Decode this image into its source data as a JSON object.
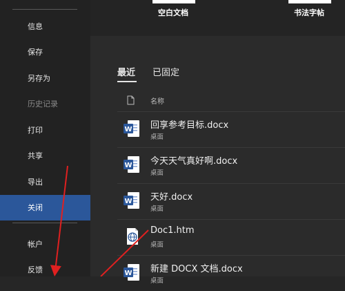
{
  "sidebar": {
    "items": [
      {
        "label": "信息"
      },
      {
        "label": "保存"
      },
      {
        "label": "另存为"
      },
      {
        "label": "历史记录"
      },
      {
        "label": "打印"
      },
      {
        "label": "共享"
      },
      {
        "label": "导出"
      },
      {
        "label": "关闭"
      },
      {
        "label": "帐户"
      },
      {
        "label": "反馈"
      }
    ],
    "active_index": 7,
    "disabled_index": 3
  },
  "templates": [
    {
      "label": "空白文档"
    },
    {
      "label": "书法字帖"
    }
  ],
  "tabs": [
    {
      "label": "最近"
    },
    {
      "label": "已固定"
    }
  ],
  "list_header": {
    "name": "名称"
  },
  "files": [
    {
      "name": "回享参考目标.docx",
      "location": "桌面",
      "icon": "word-icon"
    },
    {
      "name": "今天天气真好啊.docx",
      "location": "桌面",
      "icon": "word-icon"
    },
    {
      "name": "天好.docx",
      "location": "桌面",
      "icon": "word-icon"
    },
    {
      "name": "Doc1.htm",
      "location": "桌面",
      "icon": "web-document-icon"
    },
    {
      "name": "新建 DOCX 文档.docx",
      "location": "桌面",
      "icon": "word-icon"
    }
  ],
  "colors": {
    "accent": "#2b579a",
    "annotation_arrow": "#e02020"
  }
}
